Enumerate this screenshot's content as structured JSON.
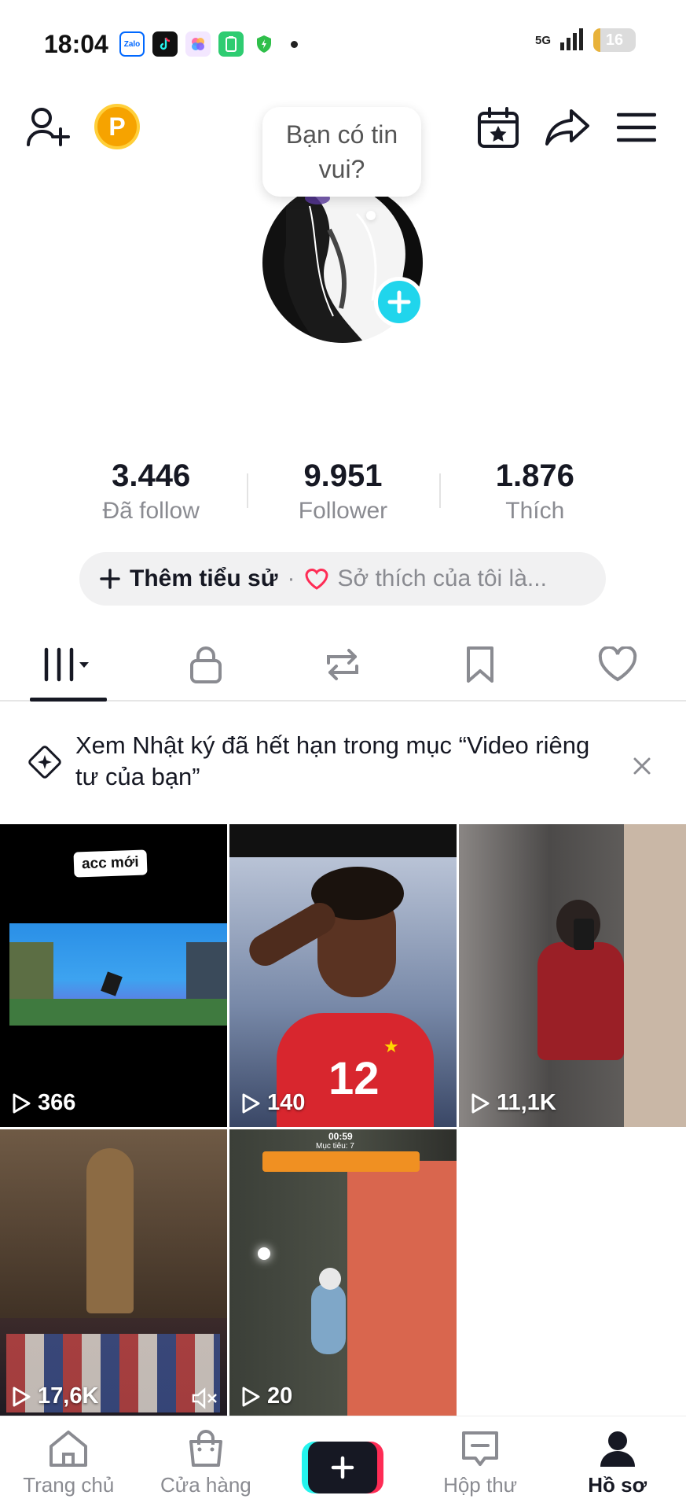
{
  "status_bar": {
    "time": "18:04",
    "apps": [
      {
        "name": "zalo-icon",
        "label": "Zalo",
        "color": "#ffffff",
        "text_color": "#0068ff"
      },
      {
        "name": "tiktok-icon",
        "label": "",
        "color": "#111111"
      },
      {
        "name": "gallery-app-icon",
        "label": "",
        "color": "#f3e7ff"
      },
      {
        "name": "battery-app-icon",
        "label": "",
        "color": "#2ecc71"
      },
      {
        "name": "shield-app-icon",
        "label": "",
        "color": "#ffffff"
      }
    ],
    "network": "5G",
    "battery_level": "16",
    "battery_fraction": 0.16
  },
  "header": {
    "coin_label": "P",
    "bubble_text": "Bạn có tin vui?"
  },
  "stats": [
    {
      "value": "3.446",
      "label": "Đã follow"
    },
    {
      "value": "9.951",
      "label": "Follower"
    },
    {
      "value": "1.876",
      "label": "Thích"
    }
  ],
  "bio": {
    "add_label": "Thêm tiểu sử",
    "separator": "·",
    "hint": "Sở thích của tôi là..."
  },
  "tabs": [
    {
      "name": "tab-videos",
      "icon": "grid-icon",
      "active": true
    },
    {
      "name": "tab-private",
      "icon": "lock-icon",
      "active": false
    },
    {
      "name": "tab-reposts",
      "icon": "repost-icon",
      "active": false
    },
    {
      "name": "tab-favorites",
      "icon": "bookmark-icon",
      "active": false
    },
    {
      "name": "tab-liked",
      "icon": "heart-icon",
      "active": false
    }
  ],
  "notice": {
    "text": "Xem Nhật ký đã hết hạn trong mục “Video riêng tư của bạn”"
  },
  "videos": [
    {
      "views": "366",
      "caption": "acc mới"
    },
    {
      "views": "140",
      "jersey": "12"
    },
    {
      "views": "11,1K"
    },
    {
      "views": "17,6K"
    },
    {
      "views": "20",
      "timer": "00:59",
      "hud_text": "Mục tiêu: 7"
    }
  ],
  "bottom_nav": [
    {
      "label": "Trang chủ",
      "icon": "home-icon",
      "active": false
    },
    {
      "label": "Cửa hàng",
      "icon": "shop-icon",
      "active": false
    },
    {
      "label": "",
      "icon": "create-icon",
      "active": false
    },
    {
      "label": "Hộp thư",
      "icon": "inbox-icon",
      "active": false
    },
    {
      "label": "Hồ sơ",
      "icon": "profile-icon",
      "active": true
    }
  ],
  "colors": {
    "accent_cyan": "#25f4ee",
    "accent_red": "#fe2c55",
    "avatar_add": "#20d5ec",
    "text_primary": "#161823",
    "text_secondary": "#8a8b91"
  }
}
